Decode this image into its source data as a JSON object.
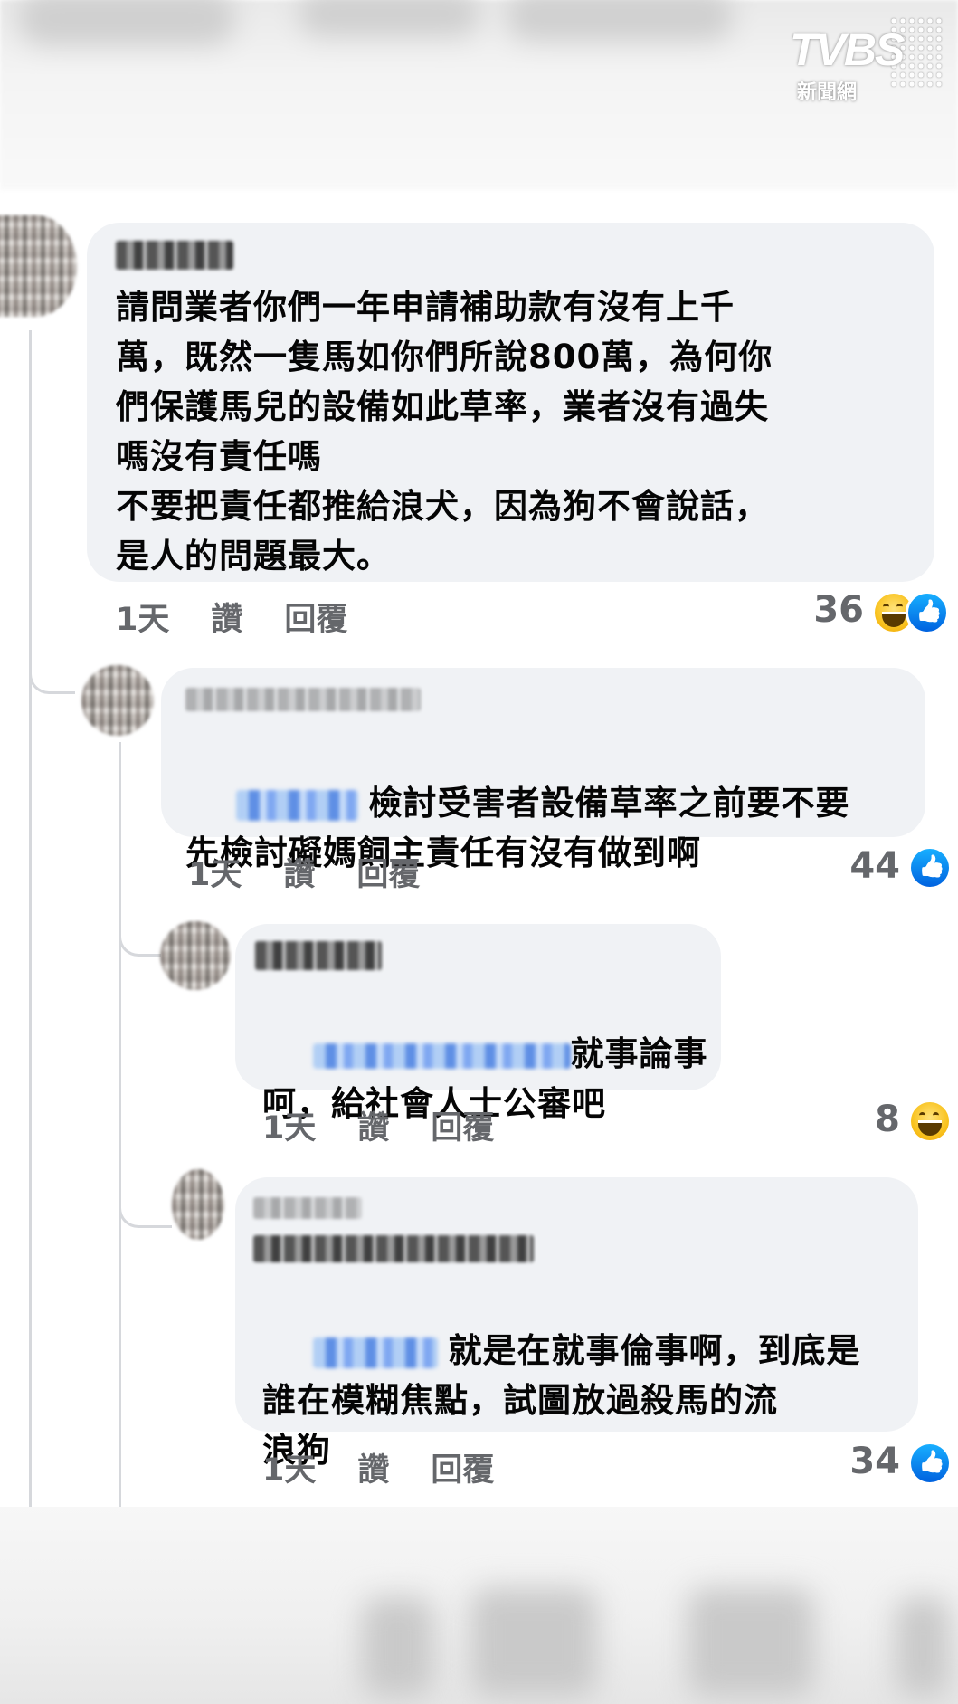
{
  "watermark": {
    "logo_text": "TVBS",
    "logo_sub": "新聞網"
  },
  "comments": [
    {
      "text": "請問業者你們一年申請補助款有沒有上千\n萬，既然一隻馬如你們所說800萬，為何你\n們保護馬兒的設備如此草率，業者沒有過失\n嗎沒有責任嗎\n不要把責任都推給浪犬，因為狗不會說話，\n是人的問題最大。",
      "time": "1天",
      "like_label": "讚",
      "reply_label": "回覆",
      "reaction_count": "36",
      "reactions": [
        "haha-icon",
        "like-icon"
      ]
    },
    {
      "text": "檢討受害者設備草率之前要不要\n先檢討礙媽飼主責任有沒有做到啊",
      "time": "1天",
      "like_label": "讚",
      "reply_label": "回覆",
      "reaction_count": "44",
      "reactions": [
        "like-icon"
      ]
    },
    {
      "text": "就事論事\n呵，給社會人士公審吧",
      "time": "1天",
      "like_label": "讚",
      "reply_label": "回覆",
      "reaction_count": "8",
      "reactions": [
        "haha-icon"
      ]
    },
    {
      "text": "就是在就事倫事啊，到底是\n誰在模糊焦點，試圖放過殺馬的流\n浪狗",
      "time": "1天",
      "like_label": "讚",
      "reply_label": "回覆",
      "reaction_count": "34",
      "reactions": [
        "like-icon"
      ]
    }
  ],
  "colors": {
    "bubble": "#f0f2f5",
    "meta": "#65676b",
    "text": "#050505",
    "like": "#1877f2"
  }
}
